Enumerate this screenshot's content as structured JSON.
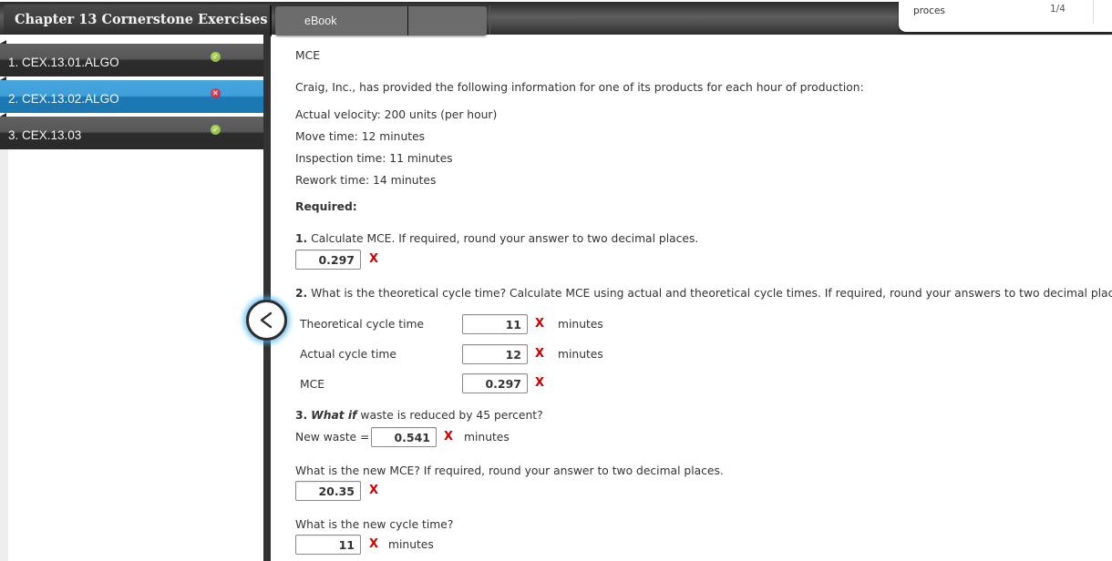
{
  "header": {
    "chapter_title": "Chapter 13 Cornerstone Exercises",
    "tabs": [
      {
        "label": "eBook"
      },
      {
        "label": ""
      }
    ]
  },
  "find_bar": {
    "query": "proces",
    "count": "1/4"
  },
  "sidebar": {
    "items": [
      {
        "label": "1. CEX.13.01.ALGO",
        "status": "correct",
        "status_icon": "✓"
      },
      {
        "label": "2. CEX.13.02.ALGO",
        "status": "incorrect",
        "status_icon": "✕",
        "active": true
      },
      {
        "label": "3. CEX.13.03",
        "status": "correct",
        "status_icon": "✓"
      }
    ],
    "collapse_icon": "chevron-left"
  },
  "colors": {
    "active_item": "#1d77b0",
    "correct": "#8ab833",
    "incorrect": "#c0243f",
    "wrong_mark": "#d40000",
    "glow": "#46b4f0"
  },
  "problem": {
    "heading": "MCE",
    "intro": "Craig, Inc., has provided the following information for one of its products for each hour of production:",
    "facts": [
      "Actual velocity: 200 units (per hour)",
      "Move time: 12 minutes",
      "Inspection time: 11 minutes",
      "Rework time: 14 minutes"
    ],
    "required_label": "Required:",
    "q1": {
      "num": "1.",
      "text": " Calculate MCE. If required, round your answer to two decimal places.",
      "answer": "0.297",
      "mark": "X"
    },
    "q2": {
      "num": "2.",
      "text": " What is the theoretical cycle time? Calculate MCE using actual and theoretical cycle times. If required, round your answers to two decimal places",
      "rows": [
        {
          "label": "Theoretical cycle time",
          "answer": "11",
          "mark": "X",
          "unit": "minutes"
        },
        {
          "label": "Actual cycle time",
          "answer": "12",
          "mark": "X",
          "unit": "minutes"
        },
        {
          "label": "MCE",
          "answer": "0.297",
          "mark": "X",
          "unit": ""
        }
      ]
    },
    "q3": {
      "num": "3.",
      "what_if": "What if",
      "text": " waste is reduced by 45 percent?",
      "new_waste_label": "New waste =",
      "new_waste_answer": "0.541",
      "new_waste_mark": "X",
      "new_waste_unit": "minutes",
      "new_mce_question": "What is the new MCE? If required, round your answer to two decimal places.",
      "new_mce_answer": "20.35",
      "new_mce_mark": "X",
      "new_cycle_question": "What is the new cycle time?",
      "new_cycle_answer": "11",
      "new_cycle_mark": "X",
      "new_cycle_unit": "minutes"
    }
  }
}
